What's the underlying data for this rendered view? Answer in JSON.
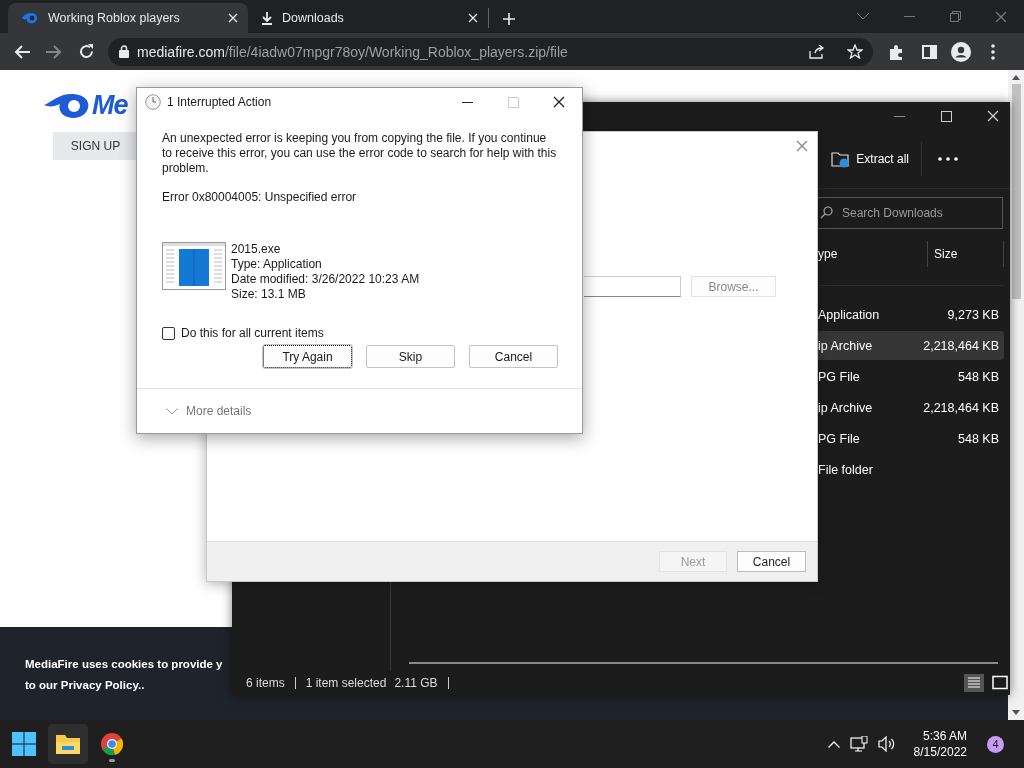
{
  "browser": {
    "tabs": [
      {
        "title": "Working Roblox players",
        "kind": "site",
        "selected": true
      },
      {
        "title": "Downloads",
        "kind": "download",
        "selected": false
      }
    ],
    "url": {
      "domain": "mediafire.com",
      "path": "/file/4iadw07mpgr78oy/Working_Roblox_players.zip/file"
    }
  },
  "page": {
    "logo_text": "Me",
    "sign_up": "SIGN UP",
    "cookie_line_1": "MediaFire uses cookies to provide y",
    "cookie_line_2": "to our ",
    "privacy_link": "Privacy Policy",
    "cookie_end": ".."
  },
  "explorer": {
    "extract_all": "Extract all",
    "search": {
      "placeholder": "Search Downloads"
    },
    "columns": [
      "ype",
      "Size"
    ],
    "rows": [
      {
        "type": "Application",
        "size": "9,273 KB",
        "selected": false
      },
      {
        "type": "ip Archive",
        "size": "2,218,464 KB",
        "selected": true
      },
      {
        "type": "PG File",
        "size": "548 KB",
        "selected": false
      },
      {
        "type": "ip Archive",
        "size": "2,218,464 KB",
        "selected": false
      },
      {
        "type": "PG File",
        "size": "548 KB",
        "selected": false
      },
      {
        "type": "File folder",
        "size": "",
        "selected": false
      }
    ],
    "status": {
      "items": "6 items",
      "selected": "1 item selected",
      "size": "2.11 GB"
    }
  },
  "wizard": {
    "browse": "Browse...",
    "next": {
      "label": "Next",
      "disabled": true
    },
    "cancel": "Cancel"
  },
  "dialog": {
    "title": "1 Interrupted Action",
    "message": "An unexpected error is keeping you from copying the file. If you continue to receive this error, you can use the error code to search for help with this problem.",
    "error": "Error 0x80004005: Unspecified error",
    "file": {
      "name": "2015.exe",
      "type": "Type: Application",
      "modified": "Date modified: 3/26/2022 10:23 AM",
      "size": "Size: 13.1 MB"
    },
    "checkbox": {
      "label": "Do this for all current items",
      "checked": false
    },
    "buttons": [
      {
        "label": "Try Again",
        "focused": true
      },
      {
        "label": "Skip",
        "focused": false
      },
      {
        "label": "Cancel",
        "focused": false
      }
    ],
    "more_details": "More details"
  },
  "taskbar": {
    "apps": [
      {
        "kind": "start",
        "active": false
      },
      {
        "kind": "folder",
        "active": true
      },
      {
        "kind": "browser",
        "active": false
      }
    ],
    "time": "5:36 AM",
    "date": "8/15/2022",
    "badge": "4"
  }
}
